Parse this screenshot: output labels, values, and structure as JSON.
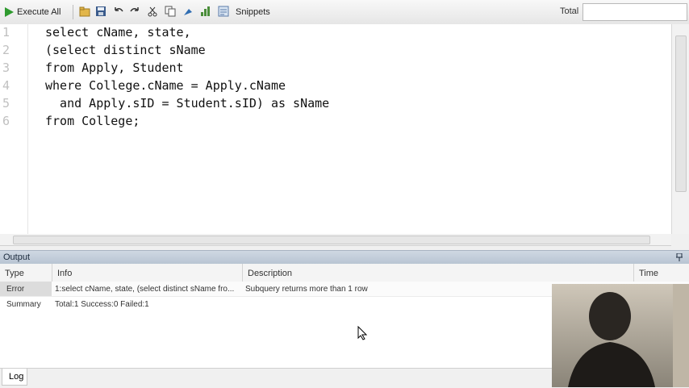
{
  "toolbar": {
    "execute_all_label": "Execute All",
    "snippets_label": "Snippets",
    "total_label": "Total"
  },
  "editor": {
    "line_numbers": [
      "1",
      "2",
      "3",
      "4",
      "5",
      "6"
    ],
    "lines": [
      "select cName, state,",
      "(select distinct sName",
      "from Apply, Student",
      "where College.cName = Apply.cName",
      "  and Apply.sID = Student.sID) as sName",
      "from College;"
    ]
  },
  "output": {
    "title": "Output",
    "columns": [
      "Type",
      "Info",
      "Description",
      "Time"
    ],
    "rows": [
      {
        "type": "Error",
        "info": "1:select cName, state, (select distinct sName fro...",
        "description": "Subquery returns more than 1 row",
        "time": ""
      },
      {
        "type": "Summary",
        "info": "Total:1 Success:0 Failed:1",
        "description": "",
        "time": ""
      }
    ]
  },
  "status": {
    "log_tab": "Log"
  }
}
